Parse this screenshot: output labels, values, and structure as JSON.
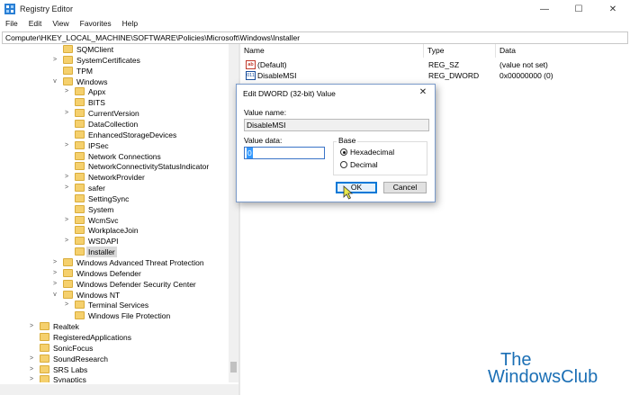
{
  "window": {
    "title": "Registry Editor",
    "minimize_glyph": "—",
    "maximize_glyph": "☐",
    "close_glyph": "✕"
  },
  "menu": [
    "File",
    "Edit",
    "View",
    "Favorites",
    "Help"
  ],
  "address": "Computer\\HKEY_LOCAL_MACHINE\\SOFTWARE\\Policies\\Microsoft\\Windows\\Installer",
  "tree": [
    {
      "label": "SQMClient",
      "expander": ""
    },
    {
      "label": "SystemCertificates",
      "expander": ">"
    },
    {
      "label": "TPM",
      "expander": ""
    },
    {
      "label": "Windows",
      "expander": "v"
    },
    {
      "label": "Appx",
      "expander": ">"
    },
    {
      "label": "BITS",
      "expander": ""
    },
    {
      "label": "CurrentVersion",
      "expander": ">"
    },
    {
      "label": "DataCollection",
      "expander": ""
    },
    {
      "label": "EnhancedStorageDevices",
      "expander": ""
    },
    {
      "label": "IPSec",
      "expander": ">"
    },
    {
      "label": "Network Connections",
      "expander": ""
    },
    {
      "label": "NetworkConnectivityStatusIndicator",
      "expander": ""
    },
    {
      "label": "NetworkProvider",
      "expander": ">"
    },
    {
      "label": "safer",
      "expander": ">"
    },
    {
      "label": "SettingSync",
      "expander": ""
    },
    {
      "label": "System",
      "expander": ""
    },
    {
      "label": "WcmSvc",
      "expander": ">"
    },
    {
      "label": "WorkplaceJoin",
      "expander": ""
    },
    {
      "label": "WSDAPI",
      "expander": ">"
    },
    {
      "label": "Installer",
      "expander": ""
    },
    {
      "label": "Windows Advanced Threat Protection",
      "expander": ">"
    },
    {
      "label": "Windows Defender",
      "expander": ">"
    },
    {
      "label": "Windows Defender Security Center",
      "expander": ">"
    },
    {
      "label": "Windows NT",
      "expander": "v"
    },
    {
      "label": "Terminal Services",
      "expander": ">"
    },
    {
      "label": "Windows File Protection",
      "expander": ""
    },
    {
      "label": "Realtek",
      "expander": ">"
    },
    {
      "label": "RegisteredApplications",
      "expander": ""
    },
    {
      "label": "SonicFocus",
      "expander": ""
    },
    {
      "label": "SoundResearch",
      "expander": ">"
    },
    {
      "label": "SRS Labs",
      "expander": ">"
    },
    {
      "label": "Synaptics",
      "expander": ">"
    }
  ],
  "list": {
    "columns": [
      "Name",
      "Type",
      "Data"
    ],
    "rows": [
      {
        "icon": "ab",
        "name": "(Default)",
        "type": "REG_SZ",
        "data": "(value not set)"
      },
      {
        "icon": "011",
        "name": "DisableMSI",
        "type": "REG_DWORD",
        "data": "0x00000000 (0)"
      }
    ]
  },
  "dialog": {
    "title": "Edit DWORD (32-bit) Value",
    "close_glyph": "✕",
    "value_name_label": "Value name:",
    "value_name": "DisableMSI",
    "value_data_label": "Value data:",
    "value_data": "0",
    "base_label": "Base",
    "radio_hex": "Hexadecimal",
    "radio_dec": "Decimal",
    "ok": "OK",
    "cancel": "Cancel"
  },
  "watermark": {
    "line1": "The",
    "line2": "WindowsClub"
  },
  "colors": {
    "folder": "#f5d06d",
    "accent": "#0078d7",
    "watermark": "#1b6fb5"
  }
}
